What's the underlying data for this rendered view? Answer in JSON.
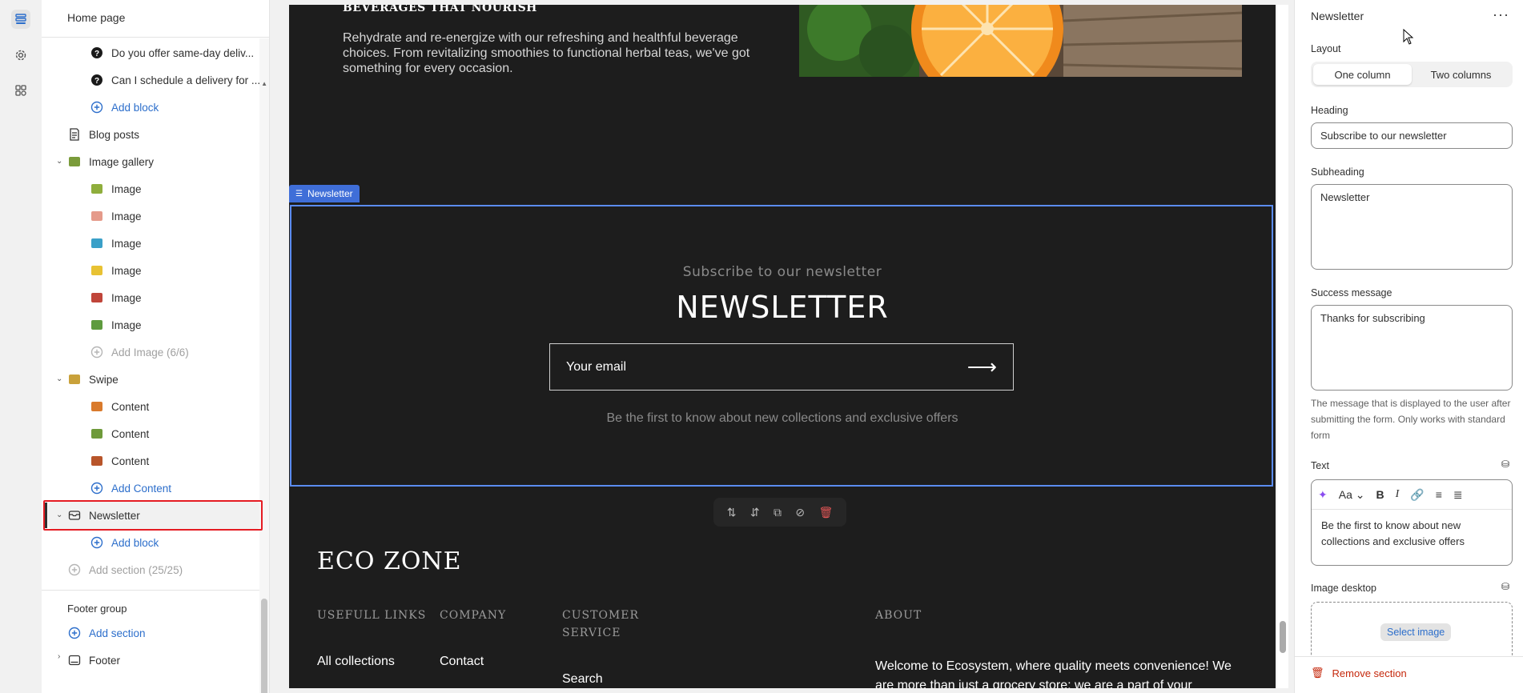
{
  "tree": {
    "title": "Home page",
    "items": [
      {
        "label": "Do you offer same-day deliv..."
      },
      {
        "label": "Can I schedule a delivery for ..."
      },
      {
        "label": "Add block"
      },
      {
        "label": "Blog posts"
      },
      {
        "label": "Image gallery"
      },
      {
        "label": "Image"
      },
      {
        "label": "Image"
      },
      {
        "label": "Image"
      },
      {
        "label": "Image"
      },
      {
        "label": "Image"
      },
      {
        "label": "Image"
      },
      {
        "label": "Add Image (6/6)"
      },
      {
        "label": "Swipe"
      },
      {
        "label": "Content"
      },
      {
        "label": "Content"
      },
      {
        "label": "Content"
      },
      {
        "label": "Add Content"
      },
      {
        "label": "Newsletter"
      },
      {
        "label": "Add block"
      },
      {
        "label": "Add section (25/25)"
      },
      {
        "label": "Footer group"
      },
      {
        "label": "Add section"
      },
      {
        "label": "Footer"
      }
    ]
  },
  "preview": {
    "bev_title": "BEVERAGES THAT NOURISH",
    "bev_text": "Rehydrate and re-energize with our refreshing and healthful beverage choices. From revitalizing smoothies to functional herbal teas, we've got something for every occasion.",
    "section_tag": "Newsletter",
    "nl_sub": "Subscribe to our newsletter",
    "nl_heading": "NEWSLETTER",
    "nl_placeholder": "Your email",
    "nl_desc": "Be the first to know about new collections and exclusive offers",
    "brand": "ECO ZONE",
    "footer_cols": [
      "USEFULL LINKS",
      "COMPANY",
      "CUSTOMER SERVICE",
      "ABOUT"
    ],
    "footer_links": [
      "All collections",
      "Contact",
      "Search"
    ],
    "about_text": "Welcome to Ecosystem, where quality meets convenience! We are more than just a grocery store; we are a part of your"
  },
  "panel": {
    "title": "Newsletter",
    "layout_label": "Layout",
    "layout_options": [
      "One column",
      "Two columns"
    ],
    "layout_selected": "One column",
    "heading_label": "Heading",
    "heading_value": "Subscribe to our newsletter",
    "subheading_label": "Subheading",
    "subheading_value": "Newsletter",
    "success_label": "Success message",
    "success_value": "Thanks for subscribing",
    "success_help": "The message that is displayed to the user after submitting the form. Only works with standard form",
    "text_label": "Text",
    "text_value": "Be the first to know about new collections and exclusive offers",
    "image_label": "Image desktop",
    "select_image": "Select image",
    "remove_section": "Remove section"
  },
  "colors": {
    "accent": "#2c6ecb",
    "selection": "#5b8cf0",
    "highlight": "#e51c23",
    "preview_bg": "#1d1d1d",
    "danger": "#c5280c"
  }
}
